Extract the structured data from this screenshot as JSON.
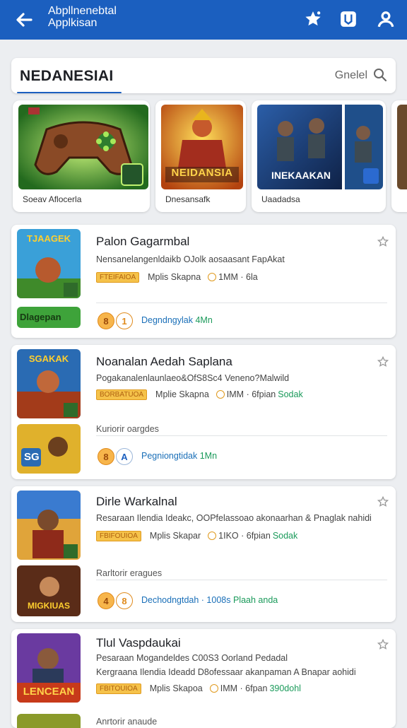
{
  "header": {
    "title_line1": "Abpllnenebtal",
    "title_line2": "Applkisan",
    "icons": [
      "back-arrow-icon",
      "star-icon",
      "bookmark-icon",
      "person-icon"
    ]
  },
  "search": {
    "value": "NEDANESIAI",
    "placeholder": "Gnelel"
  },
  "banners": [
    {
      "caption": "Soeav Aflocerla",
      "art_text": ""
    },
    {
      "caption": "Dnesansafk",
      "art_text": "NEIDANSIA"
    },
    {
      "caption": "Uaadadsa",
      "art_text": "INEKAAKAN"
    }
  ],
  "apps": [
    {
      "name": "Palon Gagarmbal",
      "description": "Nensanelangenldaikb OJolk aosaasant FapAkat",
      "badge": "FTEIFAIOA",
      "label": "Mplis Skapna",
      "size": "1MM · 6la",
      "thumb_text": "TJAAGEK",
      "second_thumb_text": "Dlagepan",
      "sub_label": "",
      "avatar1": "8",
      "avatar2": "1",
      "download_text": "Degndngylak",
      "download_count": "4Mn"
    },
    {
      "name": "Noanalan Aedah Saplana",
      "description": "Pogakanalenlaunlaeo&OfS8Sc4 Veneno?Malwild",
      "badge": "BORBATUOA",
      "label": "Mplie Skapna",
      "size": "IMM · 6fpian",
      "size_green": "Sodak",
      "thumb_text": "SGAKAK",
      "second_thumb_text": "SG",
      "sub_label": "Kuriorir oargdes",
      "avatar1": "8",
      "avatar2": "A",
      "download_text": "Pegniongtidak",
      "download_count": "1Mn"
    },
    {
      "name": "Dirle Warkalnal",
      "description": "Resaraan Ilendia Ideakc, OOPfelassoao akonaarhan & Pnaglak nahidi",
      "badge": "FBIFOUIOA",
      "label": "Mplis Skapar",
      "size": "1IKO · 6fpian",
      "size_green": "Sodak",
      "thumb_text": "",
      "second_thumb_text": "MIGKIUAS",
      "sub_label": "Rarltorir eragues",
      "avatar1": "4",
      "avatar2": "8",
      "download_text": "Dechodngtdah · 1008s",
      "download_count": "Plaah anda"
    },
    {
      "name": "Tlul Vaspdaukai",
      "description": "Pesaraan Mogandeldes C00S3 Oorland Pedadal",
      "description2": "Kergraana Ilendia Ideadd D8ofessaar akanpaman A Bnapar aohidi",
      "badge": "FBITOUIOA",
      "label": "Mplis Skapoa",
      "size": "IMM · 6fpan",
      "size_green": "390dohl",
      "thumb_text": "LENCEAN",
      "second_thumb_text": "",
      "sub_label": "Anrtorir anaude"
    }
  ]
}
